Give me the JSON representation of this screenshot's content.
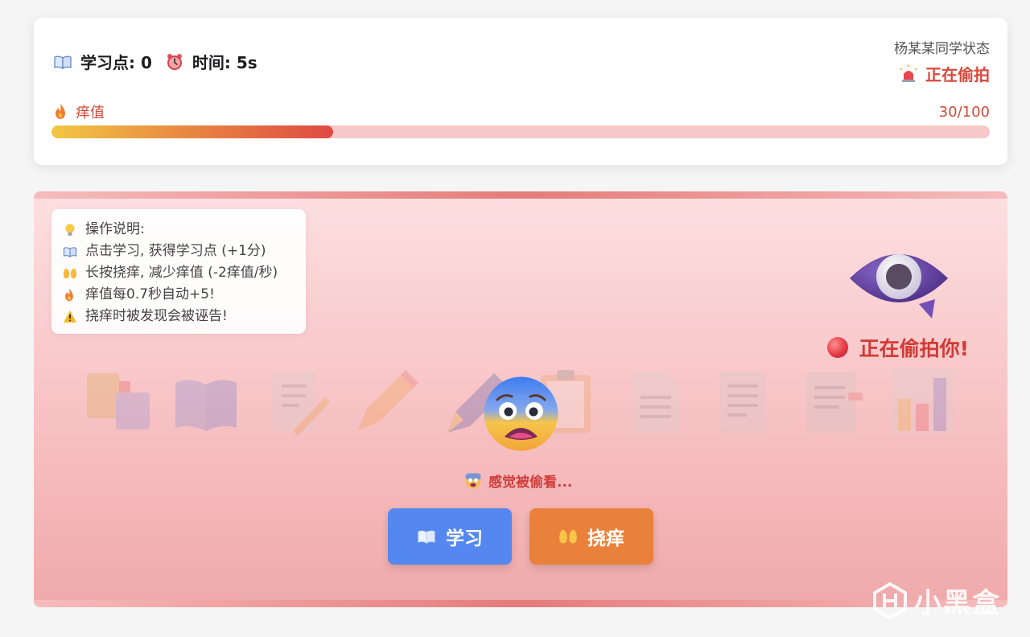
{
  "status": {
    "study_label": "学习点: 0",
    "time_label": "时间: 5s",
    "target_name": "杨某某同学状态",
    "target_state": "正在偷拍"
  },
  "itch": {
    "label": "痒值",
    "value_text": "30/100",
    "value": 30,
    "max": 100
  },
  "instructions": {
    "title": "操作说明:",
    "lines": [
      "点击学习, 获得学习点 (+1分)",
      "长按挠痒, 减少痒值 (-2痒值/秒)",
      "痒值每0.7秒自动+5!",
      "挠痒时被发现会被诬告!"
    ]
  },
  "watcher": {
    "label": "正在偷拍你!"
  },
  "feeling": "感觉被偷看...",
  "buttons": {
    "study": "学习",
    "scratch": "挠痒"
  },
  "watermark": "小黑盒",
  "icons": {
    "study": "open-book-icon",
    "time": "alarm-clock-icon",
    "state": "siren-icon",
    "itch": "fire-icon",
    "tip": "light-bulb-icon",
    "warning": "warning-icon",
    "scratch": "raised-hands-icon",
    "watcher": "eye-icon",
    "face": "scared-face-icon"
  },
  "colors": {
    "accent_red": "#d9483b",
    "study_button": "#5487f0",
    "scratch_button": "#ea813b",
    "bar_track": "#f5c9c9"
  }
}
